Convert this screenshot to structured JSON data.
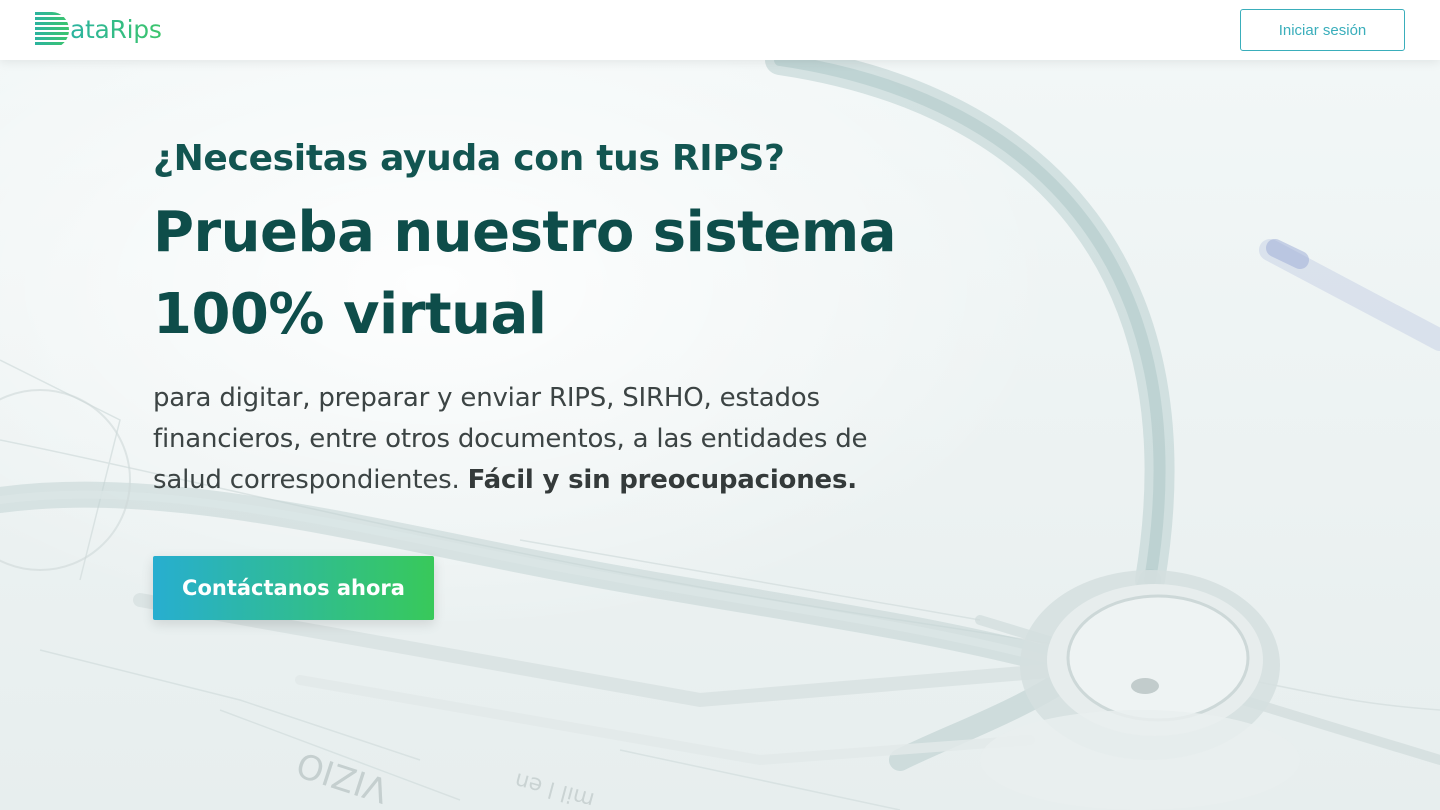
{
  "header": {
    "logo_text": "ataRips",
    "login_label": "Iniciar sesión"
  },
  "hero": {
    "subtitle": "¿Necesitas ayuda con tus RIPS?",
    "title_line1": "Prueba nuestro sistema",
    "title_line2": "100% virtual",
    "description": "para digitar, preparar y enviar RIPS, SIRHO, estados financieros, entre otros documentos, a las entidades de salud correspondientes. ",
    "description_bold": "Fácil y sin preocupaciones.",
    "cta_label": "Contáctanos ahora",
    "background_image_text": [
      "VIZIO",
      "mil l en"
    ]
  },
  "colors": {
    "brand_teal": "#3aaebb",
    "heading_dark": "#0e4d4a",
    "cta_start": "#27aed0",
    "cta_end": "#38c95a"
  },
  "icons": {
    "logo_mark": "striped-d-logo-icon",
    "background": "stethoscope-illustration"
  }
}
